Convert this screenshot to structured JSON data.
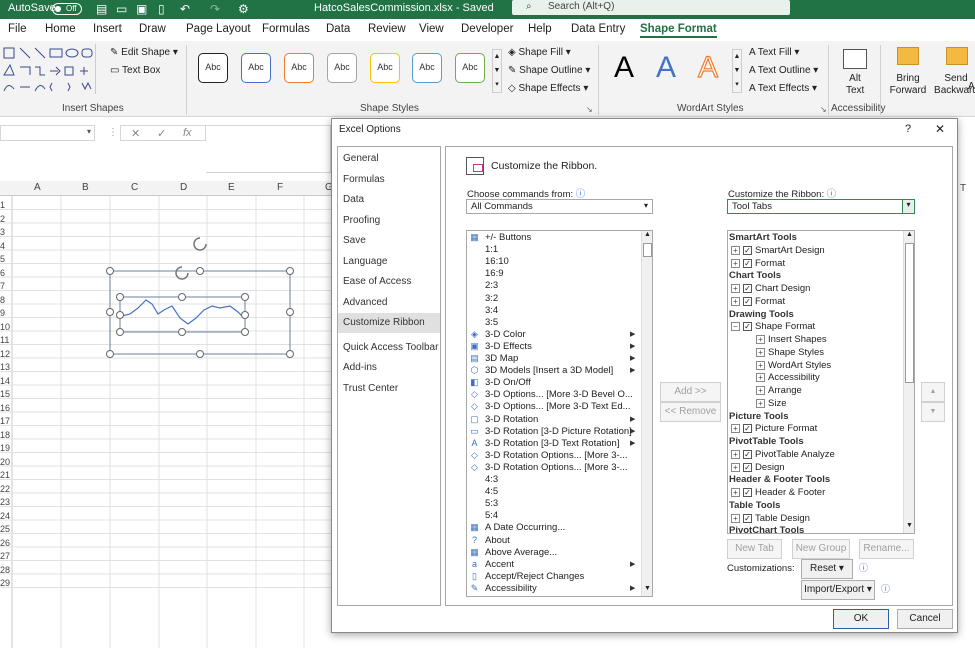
{
  "titlebar": {
    "autosave_label": "AutoSave",
    "autosave_state": "Off",
    "filename": "HatcoSalesCommission.xlsx - Saved",
    "search_placeholder": "Search (Alt+Q)"
  },
  "menu": [
    "File",
    "Home",
    "Insert",
    "Draw",
    "Page Layout",
    "Formulas",
    "Data",
    "Review",
    "View",
    "Developer",
    "Help",
    "Data Entry",
    "Shape Format"
  ],
  "ribbon": {
    "insert_shapes_label": "Insert Shapes",
    "edit_shape": "Edit Shape",
    "text_box": "Text Box",
    "shape_styles_label": "Shape Styles",
    "style_box_text": "Abc",
    "shape_fill": "Shape Fill",
    "shape_outline": "Shape Outline",
    "shape_effects": "Shape Effects",
    "wordart_label": "WordArt Styles",
    "wordart_letter": "A",
    "text_fill": "Text Fill",
    "text_outline": "Text Outline",
    "text_effects": "Text Effects",
    "accessibility_label": "Accessibility",
    "alt_text": "Alt Text",
    "bring_forward": "Bring Forward",
    "send_backward": "Send Backward",
    "arrange_partial": "A"
  },
  "formula": {
    "fx": "fx",
    "cancel": "✕",
    "enter": "✓"
  },
  "grid": {
    "columns": [
      "A",
      "B",
      "C",
      "D",
      "E",
      "F",
      "G"
    ],
    "rows": [
      "1",
      "2",
      "3",
      "4",
      "5",
      "6",
      "7",
      "8",
      "9",
      "10",
      "11",
      "12",
      "13",
      "14",
      "15",
      "16",
      "17",
      "18",
      "19",
      "20",
      "21",
      "22",
      "23",
      "24",
      "25",
      "26",
      "27",
      "28",
      "29"
    ],
    "right_col": "T"
  },
  "dialog": {
    "title": "Excel Options",
    "help": "?",
    "close": "✕",
    "nav": [
      "General",
      "Formulas",
      "Data",
      "Proofing",
      "Save",
      "Language",
      "Ease of Access",
      "Advanced",
      "Customize Ribbon",
      "Quick Access Toolbar",
      "Add-ins",
      "Trust Center"
    ],
    "nav_selected": "Customize Ribbon",
    "heading": "Customize the Ribbon.",
    "choose_label": "Choose commands from:",
    "choose_value": "All Commands",
    "customize_label": "Customize the Ribbon:",
    "customize_value": "Tool Tabs",
    "commands": [
      {
        "label": "+/- Buttons",
        "icon": "▦",
        "sub": false
      },
      {
        "label": "1:1",
        "icon": "",
        "sub": false
      },
      {
        "label": "16:10",
        "icon": "",
        "sub": false
      },
      {
        "label": "16:9",
        "icon": "",
        "sub": false
      },
      {
        "label": "2:3",
        "icon": "",
        "sub": false
      },
      {
        "label": "3:2",
        "icon": "",
        "sub": false
      },
      {
        "label": "3:4",
        "icon": "",
        "sub": false
      },
      {
        "label": "3:5",
        "icon": "",
        "sub": false
      },
      {
        "label": "3-D Color",
        "icon": "◈",
        "sub": true
      },
      {
        "label": "3-D Effects",
        "icon": "▣",
        "sub": true
      },
      {
        "label": "3D Map",
        "icon": "▤",
        "sub": true
      },
      {
        "label": "3D Models [Insert a 3D Model]",
        "icon": "⬡",
        "sub": true
      },
      {
        "label": "3-D On/Off",
        "icon": "◧",
        "sub": false
      },
      {
        "label": "3-D Options... [More 3-D Bevel O...",
        "icon": "◇",
        "sub": false
      },
      {
        "label": "3-D Options... [More 3-D Text Ed...",
        "icon": "◇",
        "sub": false
      },
      {
        "label": "3-D Rotation",
        "icon": "▢",
        "sub": true
      },
      {
        "label": "3-D Rotation [3-D Picture Rotation]",
        "icon": "▭",
        "sub": true
      },
      {
        "label": "3-D Rotation [3-D Text Rotation]",
        "icon": "A",
        "sub": true
      },
      {
        "label": "3-D Rotation Options... [More 3-...",
        "icon": "◇",
        "sub": false
      },
      {
        "label": "3-D Rotation Options... [More 3-...",
        "icon": "◇",
        "sub": false
      },
      {
        "label": "4:3",
        "icon": "",
        "sub": false
      },
      {
        "label": "4:5",
        "icon": "",
        "sub": false
      },
      {
        "label": "5:3",
        "icon": "",
        "sub": false
      },
      {
        "label": "5:4",
        "icon": "",
        "sub": false
      },
      {
        "label": "A Date Occurring...",
        "icon": "▦",
        "sub": false
      },
      {
        "label": "About",
        "icon": "?",
        "sub": false
      },
      {
        "label": "Above Average...",
        "icon": "▦",
        "sub": false
      },
      {
        "label": "Accent",
        "icon": "a",
        "sub": true
      },
      {
        "label": "Accept/Reject Changes",
        "icon": "▯",
        "sub": false
      },
      {
        "label": "Accessibility",
        "icon": "✎",
        "sub": true
      }
    ],
    "add_button": "Add >>",
    "remove_button": "<< Remove",
    "tabs_tree": [
      {
        "label": "SmartArt Tools",
        "type": "header"
      },
      {
        "label": "SmartArt Design",
        "type": "tab"
      },
      {
        "label": "Format",
        "type": "tab"
      },
      {
        "label": "Chart Tools",
        "type": "header"
      },
      {
        "label": "Chart Design",
        "type": "tab"
      },
      {
        "label": "Format",
        "type": "tab"
      },
      {
        "label": "Drawing Tools",
        "type": "header"
      },
      {
        "label": "Shape Format",
        "type": "tab-open"
      },
      {
        "label": "Insert Shapes",
        "type": "group"
      },
      {
        "label": "Shape Styles",
        "type": "group"
      },
      {
        "label": "WordArt Styles",
        "type": "group"
      },
      {
        "label": "Accessibility",
        "type": "group"
      },
      {
        "label": "Arrange",
        "type": "group"
      },
      {
        "label": "Size",
        "type": "group"
      },
      {
        "label": "Picture Tools",
        "type": "header"
      },
      {
        "label": "Picture Format",
        "type": "tab"
      },
      {
        "label": "PivotTable Tools",
        "type": "header"
      },
      {
        "label": "PivotTable Analyze",
        "type": "tab"
      },
      {
        "label": "Design",
        "type": "tab"
      },
      {
        "label": "Header & Footer Tools",
        "type": "header"
      },
      {
        "label": "Header & Footer",
        "type": "tab"
      },
      {
        "label": "Table Tools",
        "type": "header"
      },
      {
        "label": "Table Design",
        "type": "tab"
      },
      {
        "label": "PivotChart Tools",
        "type": "header"
      }
    ],
    "new_tab": "New Tab",
    "new_group": "New Group",
    "rename": "Rename...",
    "customizations_label": "Customizations:",
    "reset": "Reset",
    "import_export": "Import/Export",
    "ok": "OK",
    "cancel": "Cancel"
  },
  "colors": {
    "excel_green": "#217346",
    "selection": "#e0e0e0"
  }
}
